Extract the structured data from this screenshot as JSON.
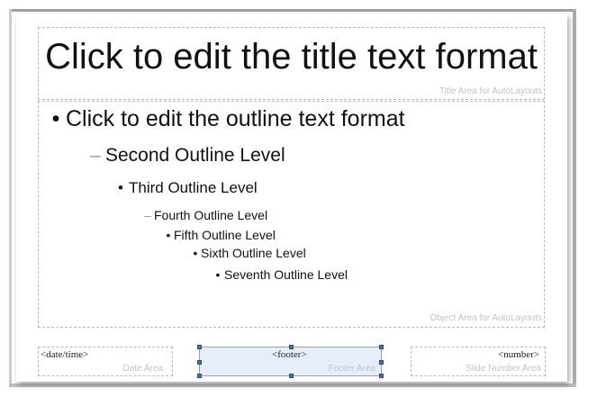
{
  "slide": {
    "title": {
      "text": "Click to edit the title text format",
      "caption": "Title Area for AutoLayouts"
    },
    "outline": {
      "caption": "Object Area for AutoLayouts",
      "levels": [
        {
          "bullet": "•",
          "text": "Click to edit the outline text format"
        },
        {
          "bullet": "–",
          "text": "Second Outline Level"
        },
        {
          "bullet": "•",
          "text": "Third Outline Level"
        },
        {
          "bullet": "–",
          "text": "Fourth Outline Level"
        },
        {
          "bullet": "•",
          "text": "Fifth Outline Level"
        },
        {
          "bullet": "•",
          "text": "Sixth Outline Level"
        },
        {
          "bullet": "•",
          "text": "Seventh Outline Level"
        }
      ]
    },
    "date_area": {
      "field": "<date/time>",
      "caption": "Date Area"
    },
    "footer_area": {
      "field": "<footer>",
      "caption": "Footer Area"
    },
    "number_area": {
      "field": "<number>",
      "caption": "Slide Number Area"
    }
  },
  "colors": {
    "selection_fill": "#cfe0f5",
    "selection_border": "#7ea7d9",
    "caption_gray": "#c3c3c3",
    "dash_gray": "#9a9a9a"
  }
}
